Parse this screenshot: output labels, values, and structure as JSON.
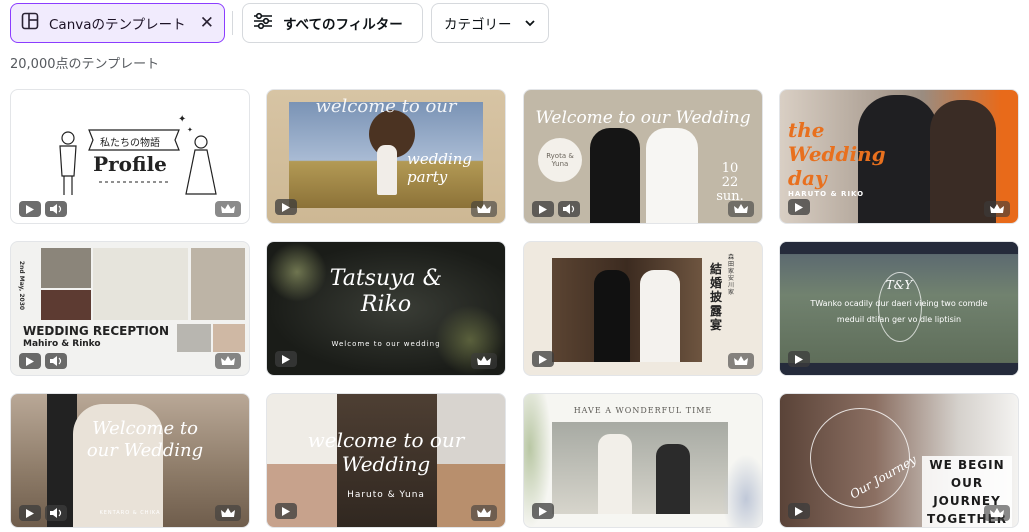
{
  "filters": {
    "active_label": "Canvaのテンプレート",
    "all_label": "すべてのフィルター",
    "category_label": "カテゴリー"
  },
  "result_count": "20,000点のテンプレート",
  "cards": [
    {
      "title": "私たちの物語",
      "subtitle": "Profile"
    },
    {
      "title": "welcome to our",
      "subtitle": "wedding party"
    },
    {
      "title": "Welcome to our Wedding",
      "names": "Ryota & Yuna",
      "date": "10\n22\nsun."
    },
    {
      "title": "the Wedding day",
      "names": "HARUTO & RIKO"
    },
    {
      "title": "WEDDING RECEPTION",
      "names": "Mahiro & Rinko",
      "date": "2nd May, 2030"
    },
    {
      "title": "Tatsuya & Riko",
      "subtitle": "Welcome to our wedding"
    },
    {
      "title": "結婚披露宴",
      "subtitle": "森田家 安川家"
    },
    {
      "title": "T&Y",
      "subtitle": "TWanko ocadily dur daeri vieing two comdie meduil dtilan ger vo dle liptisin"
    },
    {
      "title": "Welcome to our Wedding",
      "names": "KENTARO & CHIKA"
    },
    {
      "title": "welcome to our Wedding",
      "names": "Haruto & Yuna"
    },
    {
      "title": "HAVE A WONDERFUL TIME"
    },
    {
      "title": "WE BEGIN\nOUR JOURNEY\nTOGETHER",
      "subtitle": "Our Journey"
    }
  ],
  "icons": {
    "play": "play-icon",
    "sound": "sound-icon",
    "premium": "crown-icon"
  }
}
